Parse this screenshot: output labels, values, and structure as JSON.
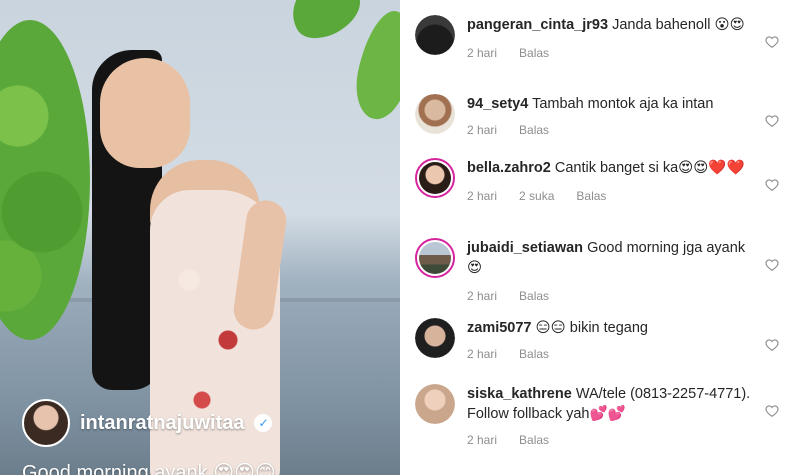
{
  "post": {
    "username": "intanratnajuwitaa",
    "caption": "Good morning ayank 😍😍😊"
  },
  "comments": [
    {
      "user": "pangeran_cinta_jr93",
      "text": "Janda bahenoll 😮😍",
      "time": "2 hari",
      "likes": "",
      "reply": "Balas"
    },
    {
      "user": "94_sety4",
      "text": "Tambah montok aja ka intan",
      "time": "2 hari",
      "likes": "",
      "reply": "Balas"
    },
    {
      "user": "bella.zahro2",
      "text": "Cantik banget si ka😍😍❤️❤️",
      "time": "2 hari",
      "likes": "2 suka",
      "reply": "Balas"
    },
    {
      "user": "jubaidi_setiawan",
      "text": "Good morning jga ayank 😍",
      "time": "2 hari",
      "likes": "",
      "reply": "Balas"
    },
    {
      "user": "zami5077",
      "text": "😑😑 bikin tegang",
      "time": "2 hari",
      "likes": "",
      "reply": "Balas"
    },
    {
      "user": "siska_kathrene",
      "text": "WA/tele (0813-2257-4771). Follow follback yah💕💕",
      "time": "2 hari",
      "likes": "",
      "reply": "Balas"
    }
  ],
  "icons": {
    "heart": "heart-outline-icon",
    "verified": "verified-badge-icon"
  },
  "colors": {
    "meta_text": "#8e8e8e",
    "story_ring": "#d6249f",
    "verified_blue": "#3897f0"
  }
}
